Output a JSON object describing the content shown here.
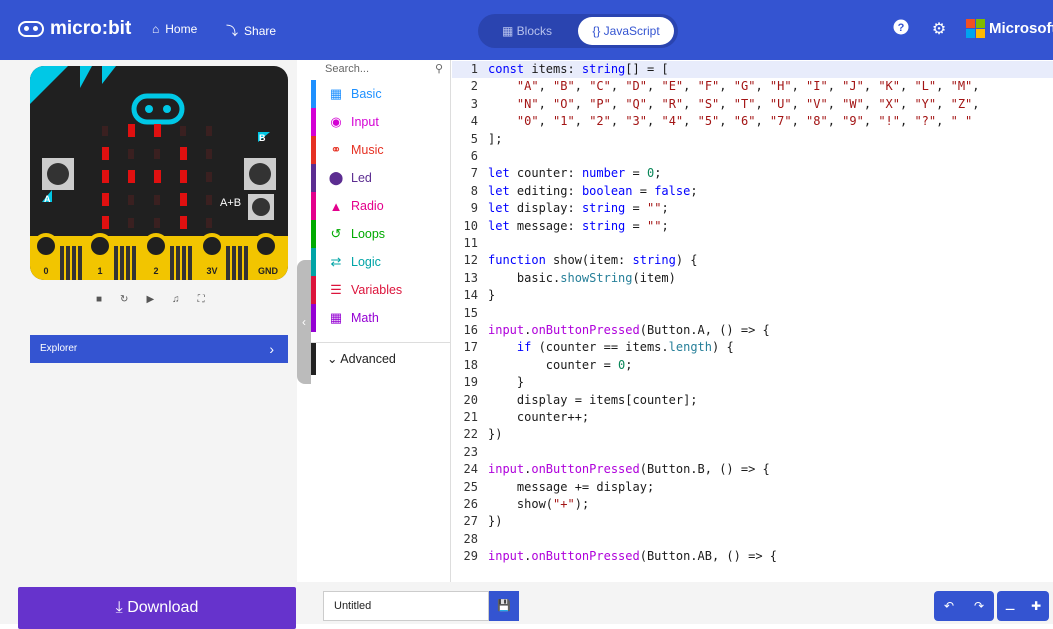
{
  "header": {
    "brand": "micro:bit",
    "home_label": "Home",
    "share_label": "Share",
    "blocks_label": "Blocks",
    "javascript_label": "{} JavaScript",
    "help_icon": "help-icon",
    "settings_icon": "gear-icon",
    "vendor": "Microsoft",
    "colors": {
      "bar": "#3454d1",
      "accent": "#6633cc"
    }
  },
  "simulator": {
    "pins": [
      "0",
      "1",
      "2",
      "3V",
      "GND"
    ],
    "button_labels": [
      "A",
      "B",
      "A+B"
    ],
    "controls": [
      "stop-icon",
      "restart-icon",
      "slow-motion-icon",
      "sound-icon",
      "fullscreen-icon"
    ],
    "explorer_label": "Explorer"
  },
  "toolbox": {
    "search_placeholder": "Search...",
    "categories": [
      {
        "label": "Basic",
        "color": "#1e90ff",
        "icon": "grid-icon"
      },
      {
        "label": "Input",
        "color": "#d400d4",
        "icon": "radio-target-icon"
      },
      {
        "label": "Music",
        "color": "#e63022",
        "icon": "headphones-icon"
      },
      {
        "label": "Led",
        "color": "#5c2d91",
        "icon": "toggle-icon"
      },
      {
        "label": "Radio",
        "color": "#e3008c",
        "icon": "signal-icon"
      },
      {
        "label": "Loops",
        "color": "#00aa00",
        "icon": "loop-icon"
      },
      {
        "label": "Logic",
        "color": "#00a4a6",
        "icon": "shuffle-icon"
      },
      {
        "label": "Variables",
        "color": "#dc143c",
        "icon": "list-icon"
      },
      {
        "label": "Math",
        "color": "#9400d3",
        "icon": "calculator-icon"
      }
    ],
    "advanced_label": "Advanced"
  },
  "editor": {
    "lines": [
      "const items: string[] = [",
      "    \"A\", \"B\", \"C\", \"D\", \"E\", \"F\", \"G\", \"H\", \"I\", \"J\", \"K\", \"L\", \"M\",",
      "    \"N\", \"O\", \"P\", \"Q\", \"R\", \"S\", \"T\", \"U\", \"V\", \"W\", \"X\", \"Y\", \"Z\",",
      "    \"0\", \"1\", \"2\", \"3\", \"4\", \"5\", \"6\", \"7\", \"8\", \"9\", \"!\", \"?\", \" \"",
      "];",
      "",
      "let counter: number = 0;",
      "let editing: boolean = false;",
      "let display: string = \"\";",
      "let message: string = \"\";",
      "",
      "function show(item: string) {",
      "    basic.showString(item)",
      "}",
      "",
      "input.onButtonPressed(Button.A, () => {",
      "    if (counter == items.length) {",
      "        counter = 0;",
      "    }",
      "    display = items[counter];",
      "    counter++;",
      "})",
      "",
      "input.onButtonPressed(Button.B, () => {",
      "    message += display;",
      "    show(\"+\");",
      "})",
      "",
      "input.onButtonPressed(Button.AB, () => {"
    ]
  },
  "footer": {
    "download_label": "Download",
    "project_name": "Untitled"
  }
}
